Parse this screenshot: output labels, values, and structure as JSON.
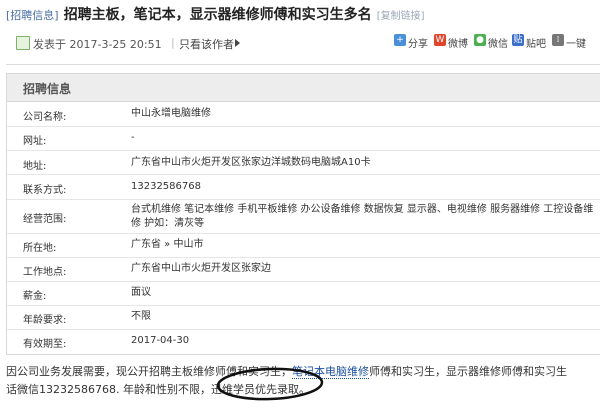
{
  "post": {
    "tag": "[招聘信息]",
    "title": "招聘主板，笔记本，显示器维修师傅和实习生多名",
    "copy_link": "[复制链接]",
    "date": "发表于 2017-3-25 20:51",
    "divider": "|",
    "only_author": "只看该作者"
  },
  "share": {
    "items": [
      {
        "label": "分享",
        "icon": "plus-share-icon",
        "color": "#4a90d9",
        "glyph": "+"
      },
      {
        "label": "微博",
        "icon": "weibo-icon",
        "color": "#e0452c",
        "glyph": "W"
      },
      {
        "label": "微信",
        "icon": "wechat-icon",
        "color": "#4caf50",
        "glyph": "●"
      },
      {
        "label": "贴吧",
        "icon": "tieba-icon",
        "color": "#3b6fc9",
        "glyph": "贴"
      },
      {
        "label": "一键",
        "icon": "grid-icon",
        "color": "#777777",
        "glyph": "⁞"
      }
    ]
  },
  "info": {
    "header": "招聘信息",
    "rows": [
      {
        "label": "公司名称:",
        "value": "中山永增电脑维修"
      },
      {
        "label": "网址:",
        "value": "-"
      },
      {
        "label": "地址:",
        "value": "广东省中山市火炬开发区张家边洋城数码电脑城A10卡"
      },
      {
        "label": "联系方式:",
        "value": "13232586768"
      },
      {
        "label": "经营范围:",
        "value": "台式机维修 笔记本维修 手机平板维修 办公设备维修 数据恢复 显示器、电视维修 服务器维修 工控设备维修 护如：清灰等"
      },
      {
        "label": "所在地:",
        "value": "广东省 » 中山市"
      },
      {
        "label": "工作地点:",
        "value": "广东省中山市火炬开发区张家边"
      },
      {
        "label": "薪金:",
        "value": "面议"
      },
      {
        "label": "年龄要求:",
        "value": "不限"
      },
      {
        "label": "有效期至:",
        "value": "2017-04-30"
      }
    ]
  },
  "body": {
    "line1_a": "因公司业务发展需要，现公开招聘主板维修师傅和实习生，",
    "line1_kw": "笔记本电脑维修",
    "line1_b": "师傅和实习生，显示器维修师傅和实习生",
    "line2_a": "话微信13232586768. 年龄和性别不限，",
    "line2_b": "迅维学员优先录取。"
  },
  "colors": {
    "link": "#1a4f9c",
    "tag": "#4a6fa5",
    "header_bg": "#ededed"
  }
}
